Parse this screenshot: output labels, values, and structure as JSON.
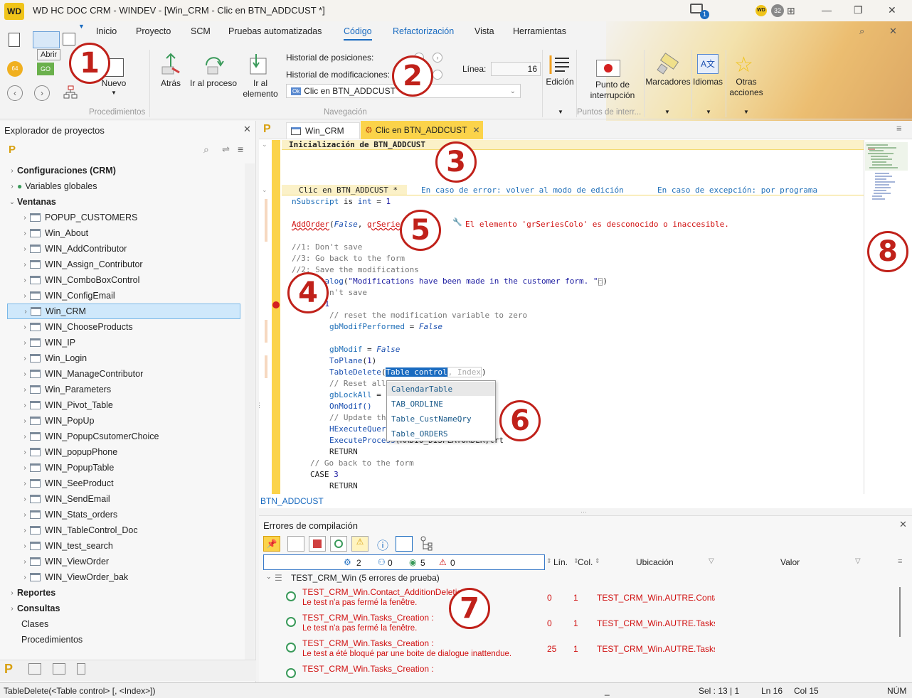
{
  "title": {
    "logo": "WD",
    "text": "WD HC DOC CRM - WINDEV - [Win_CRM - Clic en BTN_ADDCUST *]",
    "notif_count": "1",
    "badge": "WD",
    "user_badge": "32"
  },
  "menu": [
    "Inicio",
    "Proyecto",
    "SCM",
    "Pruebas automatizadas",
    "Código",
    "Refactorización",
    "Vista",
    "Herramientas"
  ],
  "ribbon": {
    "tooltip_open": "Abrir",
    "nuevo": "Nuevo",
    "procedimientos": "Procedimientos",
    "atras": "Atrás",
    "ir_proceso": "Ir al proceso",
    "ir_elemento": "Ir al elemento",
    "historial_posiciones": "Historial de posiciones:",
    "historial_modificaciones": "Historial de modificaciones:",
    "linea_label": "Línea:",
    "linea_value": "16",
    "combo_value": "Clic en BTN_ADDCUST",
    "navegacion": "Navegación",
    "edicion": "Edición",
    "punto_interrupcion": "Punto de interrupción",
    "puntos_grp": "Puntos de interr...",
    "marcadores": "Marcadores",
    "idiomas": "Idiomas",
    "otras_acciones": "Otras acciones"
  },
  "explorer": {
    "title": "Explorador de proyectos",
    "items": [
      {
        "label": "Configuraciones (CRM)",
        "bold": true,
        "level": 0
      },
      {
        "label": "Variables globales",
        "bold": false,
        "level": 0
      },
      {
        "label": "Ventanas",
        "bold": true,
        "level": 0
      },
      {
        "label": "POPUP_CUSTOMERS",
        "level": 1
      },
      {
        "label": "Win_About",
        "level": 1
      },
      {
        "label": "WIN_AddContributor",
        "level": 1
      },
      {
        "label": "WIN_Assign_Contributor",
        "level": 1
      },
      {
        "label": "WIN_ComboBoxControl",
        "level": 1
      },
      {
        "label": "WIN_ConfigEmail",
        "level": 1
      },
      {
        "label": "Win_CRM",
        "level": 1,
        "selected": true
      },
      {
        "label": "WIN_ChooseProducts",
        "level": 1
      },
      {
        "label": "WIN_IP",
        "level": 1
      },
      {
        "label": "Win_Login",
        "level": 1
      },
      {
        "label": "WIN_ManageContributor",
        "level": 1
      },
      {
        "label": "Win_Parameters",
        "level": 1
      },
      {
        "label": "WIN_Pivot_Table",
        "level": 1
      },
      {
        "label": "WIN_PopUp",
        "level": 1
      },
      {
        "label": "WIN_PopupCsutomerChoice",
        "level": 1
      },
      {
        "label": "WIN_popupPhone",
        "level": 1
      },
      {
        "label": "WIN_PopupTable",
        "level": 1
      },
      {
        "label": "WIN_SeeProduct",
        "level": 1
      },
      {
        "label": "WIN_SendEmail",
        "level": 1
      },
      {
        "label": "WIN_Stats_orders",
        "level": 1
      },
      {
        "label": "WIN_TableControl_Doc",
        "level": 1
      },
      {
        "label": "WIN_test_search",
        "level": 1
      },
      {
        "label": "WIN_ViewOrder",
        "level": 1
      },
      {
        "label": "WIN_ViewOrder_bak",
        "level": 1
      },
      {
        "label": "Reportes",
        "bold": true,
        "level": 0
      },
      {
        "label": "Consultas",
        "bold": true,
        "level": 0
      },
      {
        "label": "Clases",
        "level": 0,
        "nochev": true
      },
      {
        "label": "Procedimientos",
        "level": 0,
        "nochev": true
      }
    ]
  },
  "editor": {
    "tabs": [
      "Win_CRM",
      "Clic en BTN_ADDCUST"
    ],
    "init_header": "Inicialización de BTN_ADDCUST",
    "click_header": "Clic en BTN_ADDCUST *",
    "on_error": "En caso de error: volver al modo de edición",
    "on_exception": "En caso de excepción: por programa",
    "error_msg": "El elemento 'grSeriesColo' es desconocido o inaccesible.",
    "footer": "BTN_ADDCUST",
    "autocomplete_hint_sel": "Table control",
    "autocomplete_hint_rest": ", Index",
    "autocomplete": [
      "CalendarTable",
      "TAB_ORDLINE",
      "Table_CustNameQry",
      "Table_ORDERS"
    ]
  },
  "errors": {
    "title": "Errores de compilación",
    "counts": [
      "2",
      "0",
      "5",
      "0"
    ],
    "cols": [
      "Lín.",
      "Col.",
      "Ubicación",
      "Valor"
    ],
    "group": "TEST_CRM_Win (5 errores de prueba)",
    "rows": [
      {
        "title": "TEST_CRM_Win.Contact_AdditionDeletio",
        "msg": "Le test n'a pas fermé la fenêtre.",
        "line": "0",
        "col": "1",
        "loc": "TEST_CRM_Win.AUTRE.Contact_"
      },
      {
        "title": "TEST_CRM_Win.Tasks_Creation :",
        "msg": "Le test n'a pas fermé la fenêtre.",
        "line": "0",
        "col": "1",
        "loc": "TEST_CRM_Win.AUTRE.Tasks_Cr"
      },
      {
        "title": "TEST_CRM_Win.Tasks_Creation :",
        "msg": "Le test a été bloqué par une boite de dialogue inattendue.",
        "line": "25",
        "col": "1",
        "loc": "TEST_CRM_Win.AUTRE.Tasks_Cr"
      },
      {
        "title": "TEST_CRM_Win.Tasks_Creation :",
        "msg": "",
        "line": "",
        "col": "",
        "loc": ""
      }
    ]
  },
  "status": {
    "left": "TableDelete(<Table control> [, <Index>])",
    "sel": "Sel : 13 | 1",
    "ln": "Ln 16",
    "col": "Col 15",
    "num": "NÚM"
  },
  "callouts": [
    "1",
    "2",
    "3",
    "4",
    "5",
    "6",
    "7",
    "8"
  ]
}
